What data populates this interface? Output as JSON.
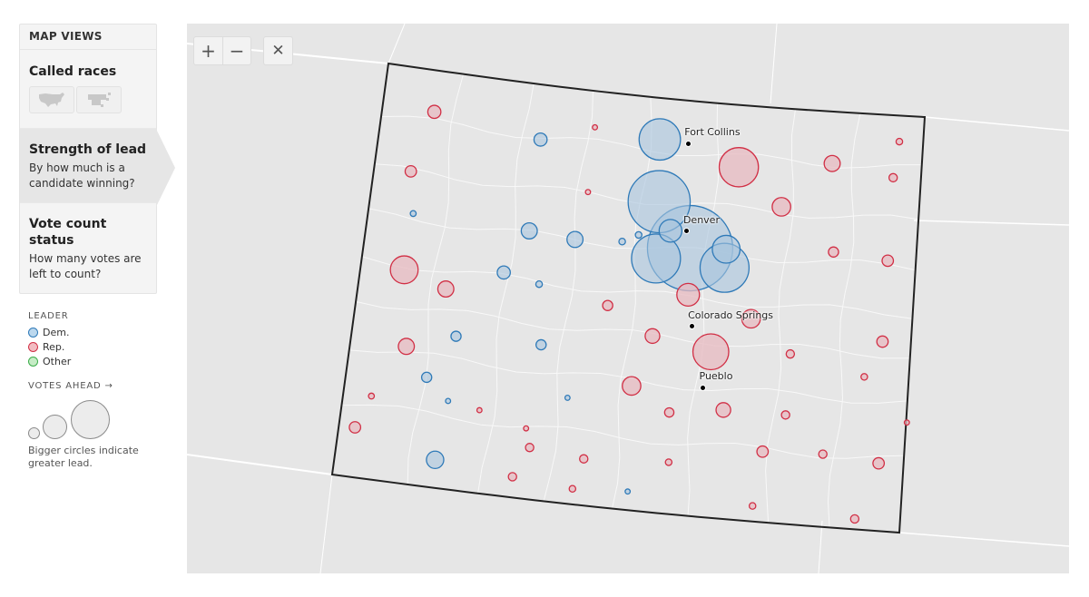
{
  "sidebar": {
    "header": "MAP VIEWS",
    "views": [
      {
        "title": "Called races",
        "description": "",
        "thumbnails": [
          "us-map-icon",
          "us-cartogram-icon"
        ]
      },
      {
        "title": "Strength of lead",
        "description": "By how much is a candidate winning?",
        "active": true
      },
      {
        "title": "Vote count status",
        "description": "How many votes are left to count?"
      }
    ]
  },
  "legend": {
    "leader_title": "LEADER",
    "leaders": [
      {
        "label": "Dem.",
        "stroke": "#2f7ab8",
        "fill": "#bcd8ee"
      },
      {
        "label": "Rep.",
        "stroke": "#d12f45",
        "fill": "#f2bcc2"
      },
      {
        "label": "Other",
        "stroke": "#3cad4a",
        "fill": "#c6ecc6"
      }
    ],
    "votes_ahead_title": "VOTES AHEAD →",
    "note": "Bigger circles indicate greater lead."
  },
  "map": {
    "controls": {
      "zoom_in": "+",
      "zoom_out": "−",
      "reset": "✕"
    },
    "state": "Colorado",
    "colors": {
      "dem_stroke": "#2f7ab8",
      "dem_fill": "#a9c4dd",
      "rep_stroke": "#d12f45",
      "rep_fill": "#e7b9c0",
      "background": "#e6e6e6",
      "border": "#222222"
    },
    "cities": [
      {
        "name": "Fort Collins",
        "lon": -105.08,
        "lat": 40.585
      },
      {
        "name": "Denver",
        "lon": -104.99,
        "lat": 39.74
      },
      {
        "name": "Colorado Springs",
        "lon": -104.82,
        "lat": 38.83
      },
      {
        "name": "Pueblo",
        "lon": -104.61,
        "lat": 38.25
      }
    ],
    "counties": [
      {
        "party": "rep",
        "lead": 2,
        "lon": -108.38,
        "lat": 40.6
      },
      {
        "party": "dem",
        "lead": 2,
        "lon": -106.98,
        "lat": 40.47
      },
      {
        "party": "rep",
        "lead": 0.3,
        "lon": -106.3,
        "lat": 40.65
      },
      {
        "party": "dem",
        "lead": 20,
        "lon": -105.45,
        "lat": 40.6
      },
      {
        "party": "rep",
        "lead": 18,
        "lon": -104.4,
        "lat": 40.4
      },
      {
        "party": "rep",
        "lead": 3,
        "lon": -103.2,
        "lat": 40.5
      },
      {
        "party": "rep",
        "lead": 0.5,
        "lon": -102.35,
        "lat": 40.75
      },
      {
        "party": "rep",
        "lead": 0.8,
        "lon": -102.4,
        "lat": 40.4
      },
      {
        "party": "rep",
        "lead": 1.5,
        "lon": -108.58,
        "lat": 40.0
      },
      {
        "party": "rep",
        "lead": 0.15,
        "lon": -106.3,
        "lat": 40.02
      },
      {
        "party": "dem",
        "lead": 45,
        "lon": -105.38,
        "lat": 40.0
      },
      {
        "party": "rep",
        "lead": 4,
        "lon": -103.81,
        "lat": 40.05
      },
      {
        "party": "dem",
        "lead": 0.4,
        "lon": -108.48,
        "lat": 39.6
      },
      {
        "party": "dem",
        "lead": 3,
        "lon": -106.99,
        "lat": 39.58
      },
      {
        "party": "dem",
        "lead": 3,
        "lon": -106.4,
        "lat": 39.55
      },
      {
        "party": "dem",
        "lead": 0.5,
        "lon": -105.8,
        "lat": 39.58
      },
      {
        "party": "dem",
        "lead": 0.5,
        "lon": -105.6,
        "lat": 39.66
      },
      {
        "party": "dem",
        "lead": 6,
        "lon": -105.2,
        "lat": 39.73
      },
      {
        "party": "dem",
        "lead": 85,
        "lon": -104.93,
        "lat": 39.58
      },
      {
        "party": "dem",
        "lead": 28,
        "lon": -105.35,
        "lat": 39.45
      },
      {
        "party": "dem",
        "lead": 9,
        "lon": -104.47,
        "lat": 39.6
      },
      {
        "party": "dem",
        "lead": 28,
        "lon": -104.47,
        "lat": 39.42
      },
      {
        "party": "rep",
        "lead": 1.2,
        "lon": -103.1,
        "lat": 39.65
      },
      {
        "party": "rep",
        "lead": 1.5,
        "lon": -102.4,
        "lat": 39.6
      },
      {
        "party": "rep",
        "lead": 9,
        "lon": -108.5,
        "lat": 39.05
      },
      {
        "party": "dem",
        "lead": 2,
        "lon": -107.25,
        "lat": 39.15
      },
      {
        "party": "dem",
        "lead": 0.5,
        "lon": -106.79,
        "lat": 39.08
      },
      {
        "party": "rep",
        "lead": 3,
        "lon": -107.95,
        "lat": 38.92
      },
      {
        "party": "rep",
        "lead": 1.2,
        "lon": -105.9,
        "lat": 38.95
      },
      {
        "party": "rep",
        "lead": 6,
        "lon": -104.9,
        "lat": 39.13
      },
      {
        "party": "rep",
        "lead": 4,
        "lon": -104.08,
        "lat": 38.95
      },
      {
        "party": "rep",
        "lead": 2.5,
        "lon": -105.3,
        "lat": 38.7
      },
      {
        "party": "rep",
        "lead": 15,
        "lon": -104.55,
        "lat": 38.6
      },
      {
        "party": "rep",
        "lead": 0.8,
        "lon": -103.55,
        "lat": 38.64
      },
      {
        "party": "rep",
        "lead": 1.5,
        "lon": -102.4,
        "lat": 38.82
      },
      {
        "party": "dem",
        "lead": 1.2,
        "lon": -107.75,
        "lat": 38.48
      },
      {
        "party": "dem",
        "lead": 1.2,
        "lon": -106.68,
        "lat": 38.5
      },
      {
        "party": "rep",
        "lead": 3,
        "lon": -108.35,
        "lat": 38.32
      },
      {
        "party": "rep",
        "lead": 4,
        "lon": -105.5,
        "lat": 38.2
      },
      {
        "party": "rep",
        "lead": 0.5,
        "lon": -102.6,
        "lat": 38.47
      },
      {
        "party": "rep",
        "lead": 0.3,
        "lon": -102.03,
        "lat": 38.06
      },
      {
        "party": "dem",
        "lead": 1.2,
        "lon": -108.05,
        "lat": 38.05
      },
      {
        "party": "dem",
        "lead": 0.25,
        "lon": -107.75,
        "lat": 37.85
      },
      {
        "party": "dem",
        "lead": 0.2,
        "lon": -106.28,
        "lat": 38.02
      },
      {
        "party": "rep",
        "lead": 1,
        "lon": -105.0,
        "lat": 37.98
      },
      {
        "party": "rep",
        "lead": 2.5,
        "lon": -104.33,
        "lat": 38.05
      },
      {
        "party": "rep",
        "lead": 0.8,
        "lon": -103.55,
        "lat": 38.05
      },
      {
        "party": "rep",
        "lead": 0.4,
        "lon": -108.7,
        "lat": 37.8
      },
      {
        "party": "rep",
        "lead": 0.2,
        "lon": -107.35,
        "lat": 37.8
      },
      {
        "party": "rep",
        "lead": 0.2,
        "lon": -106.75,
        "lat": 37.68
      },
      {
        "party": "rep",
        "lead": 1.5,
        "lon": -103.8,
        "lat": 37.68
      },
      {
        "party": "rep",
        "lead": 0.8,
        "lon": -103.05,
        "lat": 37.7
      },
      {
        "party": "rep",
        "lead": 1.5,
        "lon": -102.35,
        "lat": 37.65
      },
      {
        "party": "rep",
        "lead": 1.5,
        "lon": -108.85,
        "lat": 37.48
      },
      {
        "party": "dem",
        "lead": 3.5,
        "lon": -107.82,
        "lat": 37.27
      },
      {
        "party": "rep",
        "lead": 0.8,
        "lon": -106.68,
        "lat": 37.5
      },
      {
        "party": "rep",
        "lead": 0.8,
        "lon": -106.0,
        "lat": 37.45
      },
      {
        "party": "rep",
        "lead": 0.5,
        "lon": -104.95,
        "lat": 37.5
      },
      {
        "party": "rep",
        "lead": 0.8,
        "lon": -106.85,
        "lat": 37.2
      },
      {
        "party": "rep",
        "lead": 0.5,
        "lon": -106.1,
        "lat": 37.15
      },
      {
        "party": "dem",
        "lead": 0.3,
        "lon": -105.42,
        "lat": 37.18
      },
      {
        "party": "rep",
        "lead": 0.5,
        "lon": -103.87,
        "lat": 37.15
      },
      {
        "party": "rep",
        "lead": 0.8,
        "lon": -102.6,
        "lat": 37.1
      }
    ]
  }
}
